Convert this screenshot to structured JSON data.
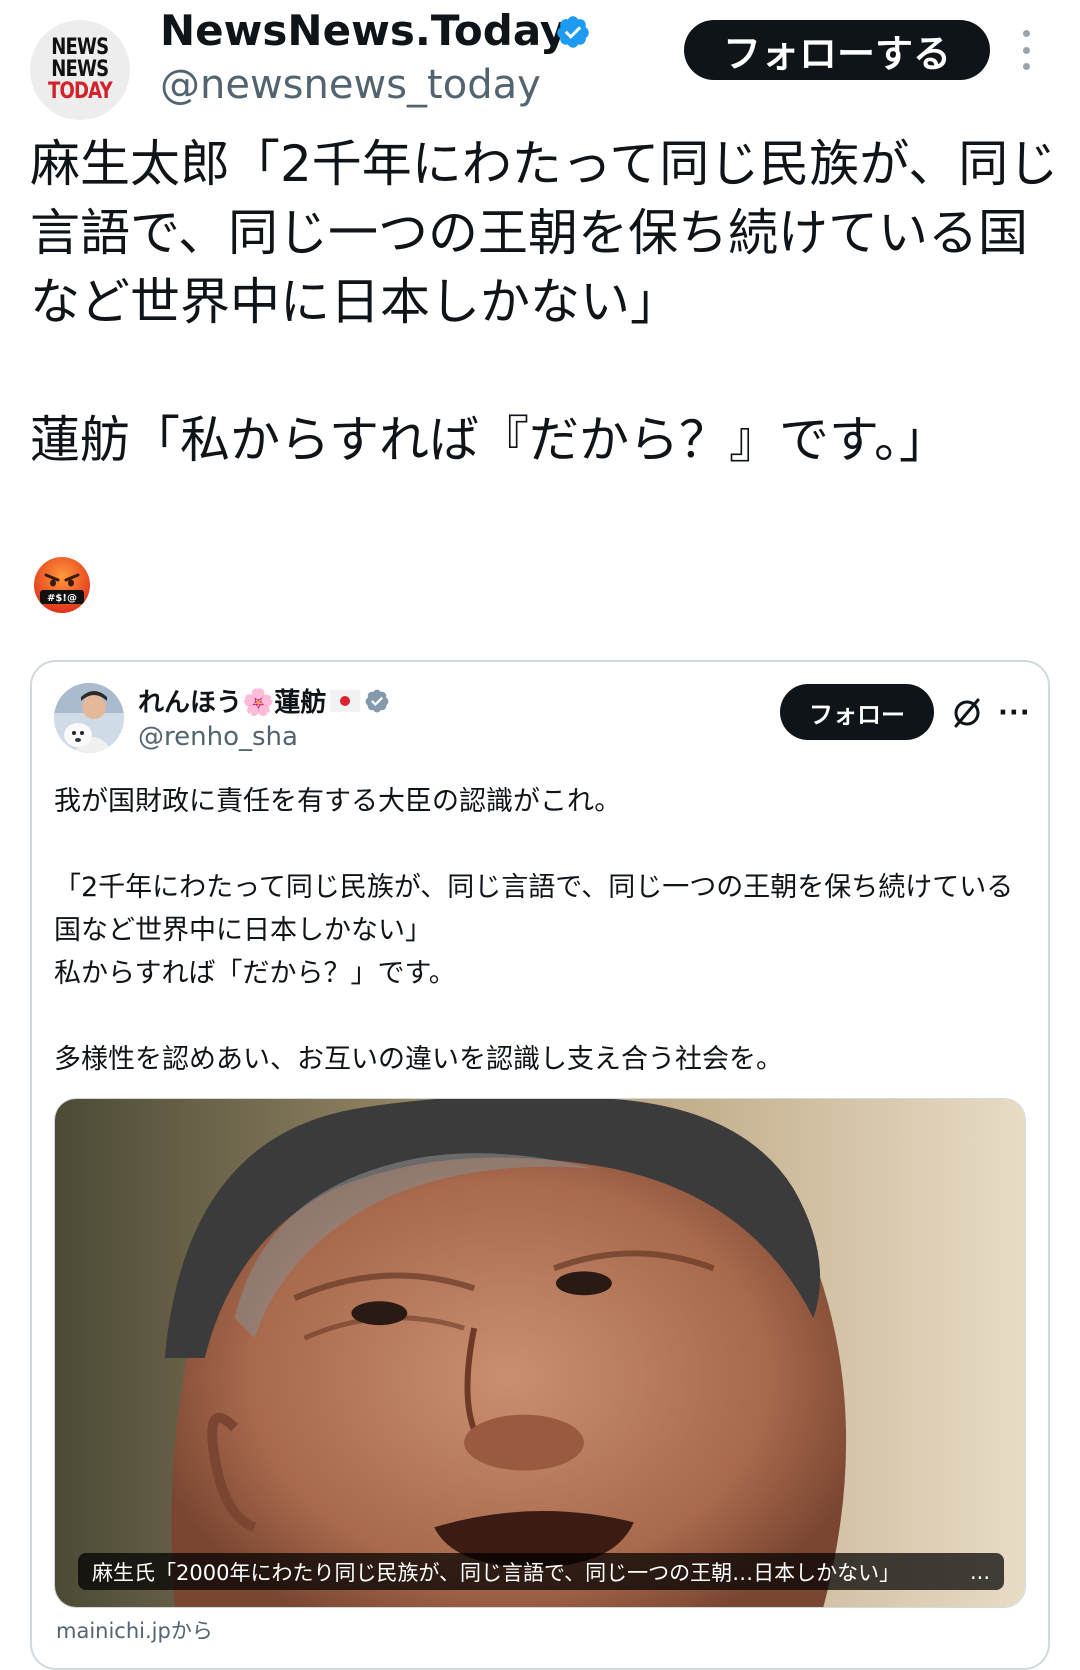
{
  "account": {
    "display_name": "NewsNews.Today",
    "handle": "@newsnews_today",
    "logo_lines": [
      "NEWS",
      "NEWS",
      "TODAY"
    ],
    "follow_label": "フォローする"
  },
  "tweet": {
    "text": "麻生太郎「2千年にわたって同じ民族が、同じ言語で、同じ一つの王朝を保ち続けている国など世界中に日本しかない」\n\n蓮舫「私からすれば『だから？』です。」",
    "emoji_text": "#$!@"
  },
  "quote": {
    "display_name": "れんほう🌸蓮舫",
    "handle": "@renho_sha",
    "follow_label": "フォロー",
    "more_label": "···",
    "text": "我が国財政に責任を有する大臣の認識がこれ。\n\n「2千年にわたって同じ民族が、同じ言語で、同じ一つの王朝を保ち続けている国など世界中に日本しかない」\n私からすれば「だから？」です。\n\n多様性を認めあい、お互いの違いを認識し支え合う社会を。",
    "image_caption": "麻生氏「2000年にわたり同じ民族が、同じ言語で、同じ一つの王朝…日本しかない」",
    "caption_more": "...",
    "source": "mainichi.jpから"
  },
  "colors": {
    "verified": "#1d9bf0",
    "button_bg": "#0f1419",
    "secondary_text": "#536471",
    "border": "#cfd9de"
  }
}
